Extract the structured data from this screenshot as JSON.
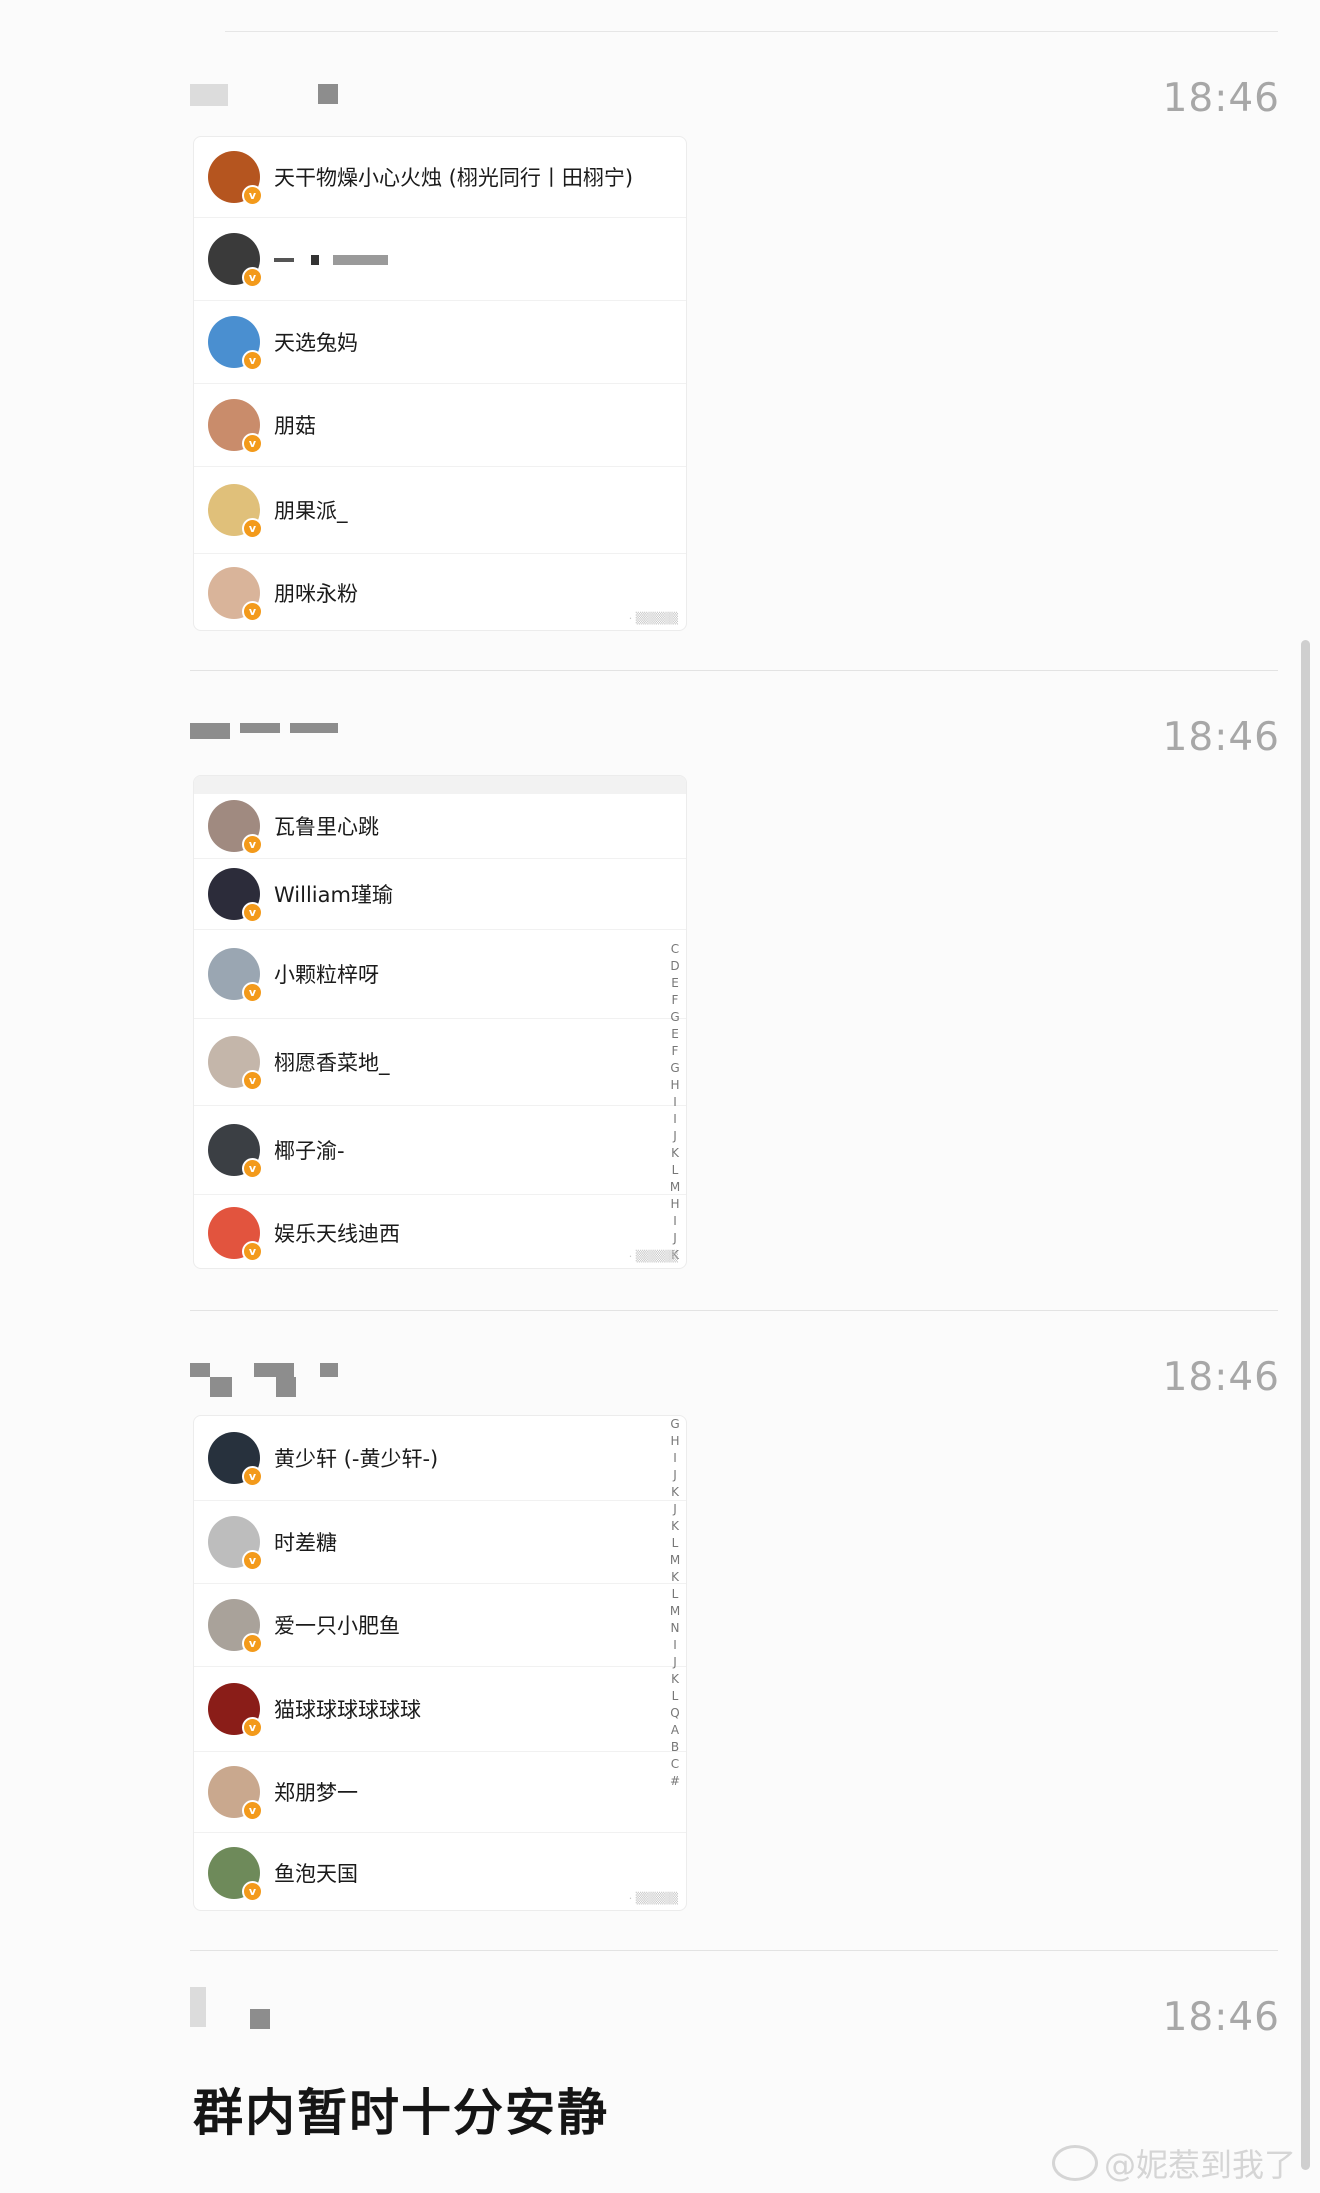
{
  "messages": [
    {
      "time": "18:46",
      "members": [
        {
          "name": "天干物燥小心火烛 (栩光同行丨田栩宁)",
          "avatar_color": "#b5551f"
        },
        {
          "name": "",
          "avatar_color": "#3a3a3a"
        },
        {
          "name": "天选兔妈",
          "avatar_color": "#4a8fd0"
        },
        {
          "name": "朋菇",
          "avatar_color": "#c98c6b"
        },
        {
          "name": "朋果派_",
          "avatar_color": "#e0c07a"
        },
        {
          "name": "朋咪永粉",
          "avatar_color": "#d9b49a"
        }
      ]
    },
    {
      "time": "18:46",
      "members": [
        {
          "name": "瓦鲁里心跳",
          "avatar_color": "#a08a80"
        },
        {
          "name": "William瑾瑜",
          "avatar_color": "#2c2c3a"
        },
        {
          "name": "小颗粒梓呀",
          "avatar_color": "#9aa6b2"
        },
        {
          "name": "栩愿香菜地_",
          "avatar_color": "#c4b6aa"
        },
        {
          "name": "椰子渝-",
          "avatar_color": "#3b3f44"
        },
        {
          "name": "娱乐天线迪西",
          "avatar_color": "#e2543e"
        }
      ],
      "alphabet": [
        "C",
        "D",
        "E",
        "F",
        "G",
        "E",
        "F",
        "G",
        "H",
        "I",
        "I",
        "J",
        "K",
        "L",
        "M",
        "H",
        "I",
        "J",
        "K"
      ]
    },
    {
      "time": "18:46",
      "members": [
        {
          "name": "黄少轩 (-黄少轩-)",
          "avatar_color": "#27313d"
        },
        {
          "name": "时差糖",
          "avatar_color": "#bdbdbd"
        },
        {
          "name": "爱一只小肥鱼",
          "avatar_color": "#a9a29a"
        },
        {
          "name": "猫球球球球球球",
          "avatar_color": "#8a1d18"
        },
        {
          "name": "郑朋梦一",
          "avatar_color": "#c9a88e"
        },
        {
          "name": "鱼泡天国",
          "avatar_color": "#6e8a5a"
        }
      ],
      "alphabet": [
        "G",
        "H",
        "I",
        "J",
        "K",
        "J",
        "K",
        "L",
        "M",
        "K",
        "L",
        "M",
        "N",
        "I",
        "J",
        "K",
        "L",
        "Q",
        "A",
        "B",
        "C",
        "#"
      ]
    },
    {
      "time": "18:46",
      "text": "群内暂时十分安静"
    }
  ],
  "watermark": "@妮惹到我了",
  "colors": {
    "verified_badge": "#f39a1b",
    "time": "#a7a7a7"
  },
  "icons": [
    "verified-badge-icon",
    "weibo-logo-icon"
  ]
}
